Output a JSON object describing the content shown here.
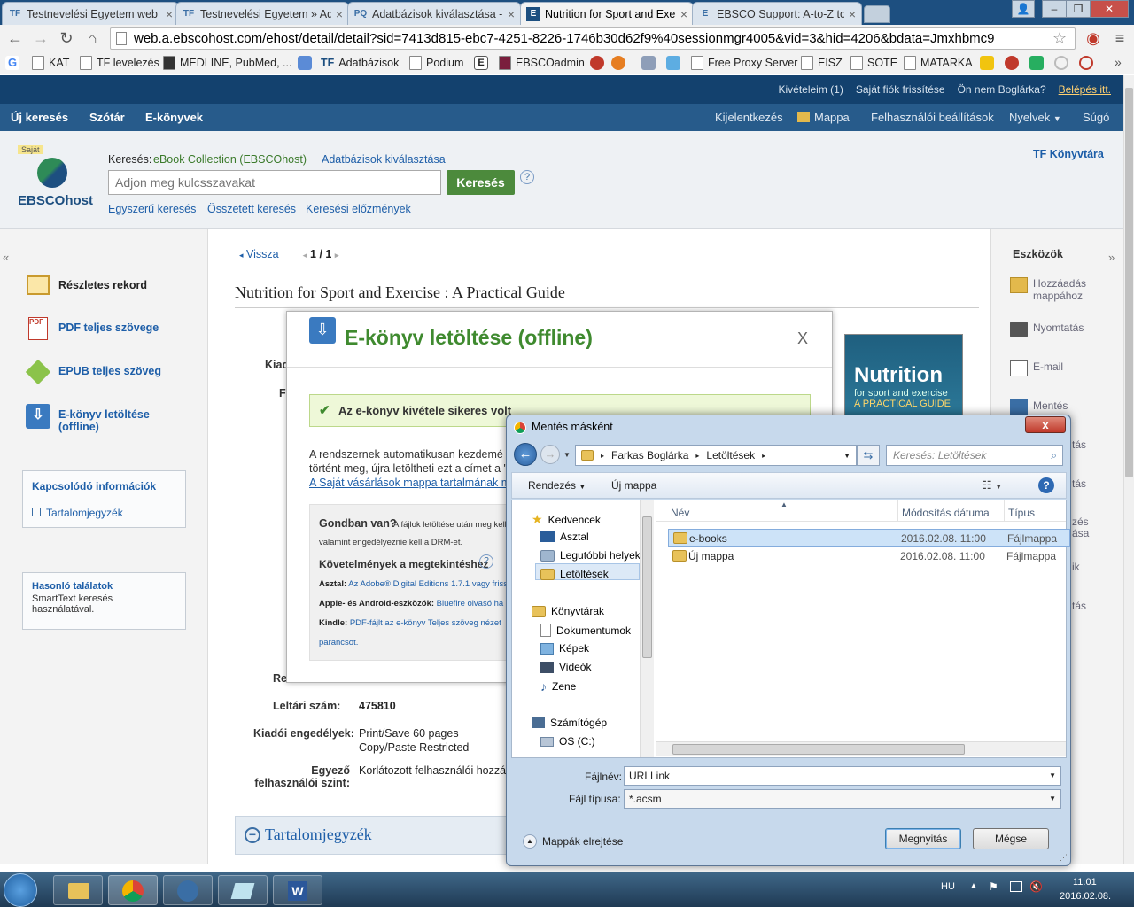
{
  "browser": {
    "tabs": [
      {
        "icon": "TF",
        "title": "Testnevelési Egyetem web"
      },
      {
        "icon": "TF",
        "title": "Testnevelési Egyetem » Ad"
      },
      {
        "icon": "PQ",
        "title": "Adatbázisok kiválasztása -"
      },
      {
        "icon": "E",
        "title": "Nutrition for Sport and Exe"
      },
      {
        "icon": "E",
        "title": "EBSCO Support: A-to-Z to"
      }
    ],
    "url": "web.a.ebscohost.com/ehost/detail/detail?sid=7413d815-ebc7-4251-8226-1746b30d62f9%40sessionmgr4005&vid=3&hid=4206&bdata=Jmxhbmc9",
    "bookmarks": [
      "KAT",
      "TF levelezés",
      "MEDLINE, PubMed, ...",
      "Adatbázisok",
      "Podium",
      "EBSCOadmin",
      "Free Proxy Server",
      "EISZ",
      "SOTE",
      "MATARKA"
    ]
  },
  "ebsco": {
    "topbar": {
      "loans": "Kivételeim (1)",
      "refresh": "Saját fiók frissítése",
      "not_user": "Ön nem Boglárka?",
      "login": "Belépés itt."
    },
    "nav": {
      "new_search": "Új keresés",
      "dictionary": "Szótár",
      "ebooks": "E-könyvek",
      "logout": "Kijelentkezés",
      "folder": "Mappa",
      "prefs": "Felhasználói beállítások",
      "languages": "Nyelvek",
      "help": "Súgó"
    },
    "search": {
      "badge": "Saját",
      "logo": "EBSCOhost",
      "searching": "Keresés:",
      "db": "eBook Collection (EBSCOhost)",
      "choose_db": "Adatbázisok kiválasztása",
      "placeholder": "Adjon meg kulcsszavakat",
      "button": "Keresés",
      "help": "?",
      "simple": "Egyszerű keresés",
      "advanced": "Összetett keresés",
      "history": "Keresési előzmények",
      "library": "TF Könyvtára"
    },
    "left": {
      "items": [
        "Részletes rekord",
        "PDF teljes szövege",
        "EPUB teljes szöveg",
        "E-könyv letöltése (offline)"
      ],
      "related_title": "Kapcsolódó információk",
      "toc": "Tartalomjegyzék",
      "similar_title": "Hasonló találatok",
      "similar_text": "SmartText keresés használatával."
    },
    "record": {
      "back": "Vissza",
      "pages": "1 / 1",
      "title": "Nutrition for Sport and Exercise : A Practical Guide",
      "cover_title": "Nutrition",
      "cover_sub": "for sport and exercise",
      "cover_guide": "A PRACTICAL GUIDE",
      "labels": {
        "kiado": "Kiad",
        "f": "F",
        "re": "Re",
        "leltari": "Leltári szám:",
        "kiadoi": "Kiadói engedélyek:",
        "egyezo": "Egyező felhasználói szint:"
      },
      "leltari_val": "475810",
      "perm1": "Print/Save 60 pages",
      "perm2": "Copy/Paste Restricted",
      "egyezo_val": "Korlátozott felhasználói hozzáf",
      "toc_heading": "Tartalomjegyzék"
    },
    "tools": {
      "title": "Eszközök",
      "items": [
        "Hozzáadás mappához",
        "Nyomtatás",
        "E-mail",
        "Mentés"
      ],
      "partial": [
        "tás",
        "tás",
        "zés ása",
        "ik",
        "tás"
      ]
    }
  },
  "modal": {
    "title": "E-könyv letöltése (offline)",
    "close": "X",
    "success": "Az e-könyv kivétele sikeres volt",
    "body1": "A rendszernek automatikusan kezdemé",
    "body2": "történt meg, újra letöltheti ezt a címet a \"",
    "link": "A Saját vásárlások mappa tartalmának m",
    "gond_title": "Gondban van?",
    "gond_text": "A fájlok letöltése után meg kell",
    "gond_text2": "valamint engedélyeznie kell a DRM-et.",
    "req_title": "Követelmények a megtekintéshez",
    "req_help": "?",
    "req": [
      {
        "label": "Asztal:",
        "text": "Az Adobe® Digital Editions 1.7.1 vagy frissebb"
      },
      {
        "label": "Apple- és Android-eszközök:",
        "text": "Bluefire olvasó ha"
      },
      {
        "label": "Kindle:",
        "text": "PDF-fájlt az e-könyv Teljes szöveg nézet"
      }
    ],
    "parancsot": "parancsot."
  },
  "dialog": {
    "title": "Mentés másként",
    "path": [
      "Farkas Boglárka",
      "Letöltések"
    ],
    "search_placeholder": "Keresés: Letöltések",
    "organize": "Rendezés",
    "new_folder": "Új mappa",
    "nav": {
      "favorites": "Kedvencek",
      "desktop": "Asztal",
      "recent": "Legutóbbi helyek",
      "downloads": "Letöltések",
      "libraries": "Könyvtárak",
      "documents": "Dokumentumok",
      "pictures": "Képek",
      "videos": "Videók",
      "music": "Zene",
      "computer": "Számítógép",
      "osc": "OS (C:)"
    },
    "columns": {
      "name": "Név",
      "modified": "Módosítás dátuma",
      "type": "Típus"
    },
    "files": [
      {
        "name": "e-books",
        "date": "2016.02.08. 11:00",
        "type": "Fájlmappa"
      },
      {
        "name": "Új mappa",
        "date": "2016.02.08. 11:00",
        "type": "Fájlmappa"
      }
    ],
    "filename_label": "Fájlnév:",
    "filename": "URLLink",
    "filetype_label": "Fájl típusa:",
    "filetype": "*.acsm",
    "hide_folders": "Mappák elrejtése",
    "open": "Megnyitás",
    "cancel": "Mégse",
    "close": "x"
  },
  "taskbar": {
    "lang": "HU",
    "time": "11:01",
    "date": "2016.02.08."
  }
}
